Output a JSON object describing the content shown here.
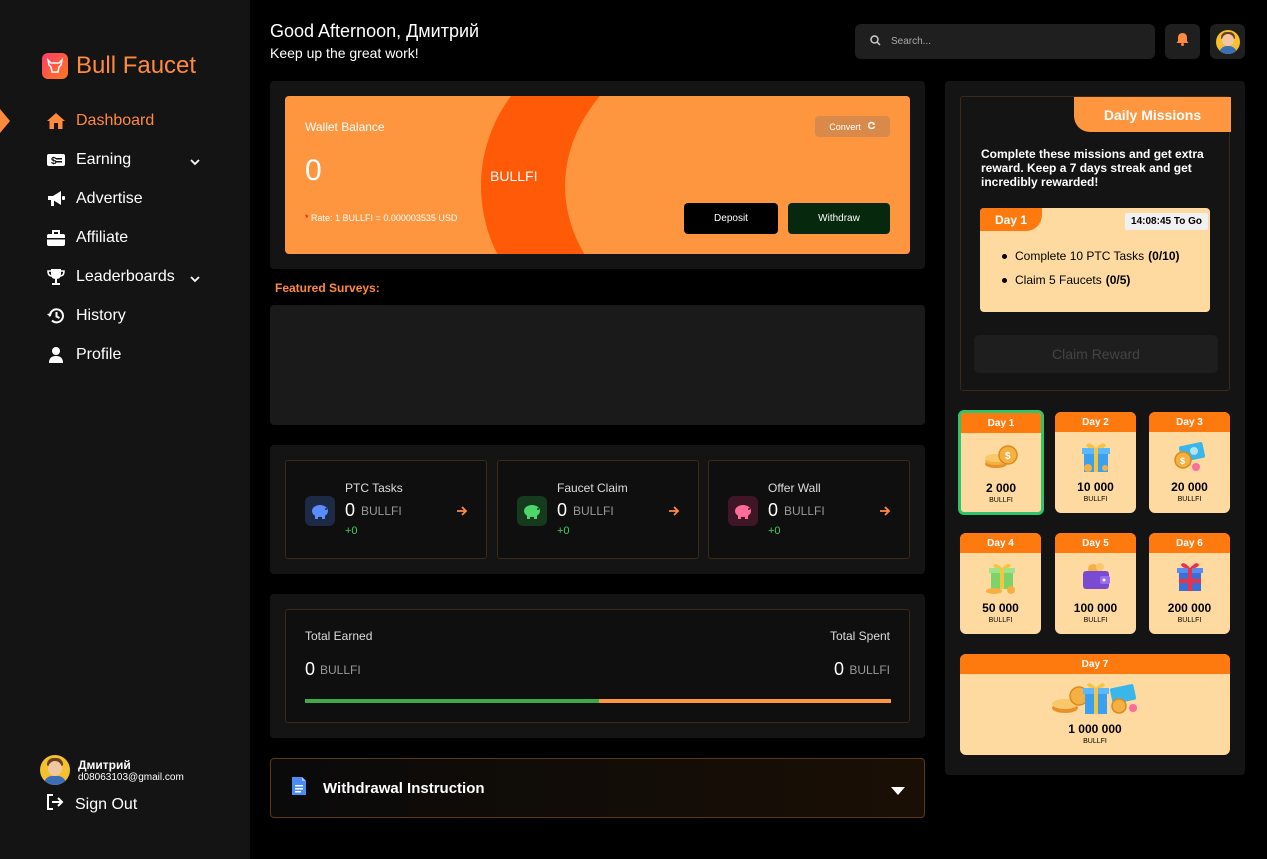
{
  "brand": {
    "name": "Bull Faucet",
    "icon": "bull-icon",
    "accent": "#ff8a3d"
  },
  "sidebar": {
    "items": [
      {
        "label": "Dashboard",
        "icon": "home-icon",
        "active": true
      },
      {
        "label": "Earning",
        "icon": "money-icon",
        "has_submenu": true
      },
      {
        "label": "Advertise",
        "icon": "megaphone-icon"
      },
      {
        "label": "Affiliate",
        "icon": "briefcase-icon"
      },
      {
        "label": "Leaderboards",
        "icon": "trophy-icon",
        "has_submenu": true
      },
      {
        "label": "History",
        "icon": "history-icon"
      },
      {
        "label": "Profile",
        "icon": "user-icon"
      }
    ],
    "user": {
      "name": "Дмитрий",
      "email": "d08063103@gmail.com"
    },
    "signout_label": "Sign Out"
  },
  "header": {
    "greeting": "Good Afternoon, Дмитрий",
    "subtitle": "Keep up the great work!",
    "search_placeholder": "Search..."
  },
  "wallet": {
    "label": "Wallet Balance",
    "balance": "0",
    "unit": "BULLFI",
    "rate_star": "*",
    "rate": "Rate: 1 BULLFI = 0.000003535 USD",
    "convert_label": "Convert",
    "deposit_label": "Deposit",
    "withdraw_label": "Withdraw"
  },
  "featured_surveys": {
    "title": "Featured Surveys:"
  },
  "stats": [
    {
      "title": "PTC Tasks",
      "value": "0",
      "unit": "BULLFI",
      "delta": "+0",
      "icon": "piggy-bank-icon",
      "color": "#5b8cff",
      "bg": "#1c2a45"
    },
    {
      "title": "Faucet Claim",
      "value": "0",
      "unit": "BULLFI",
      "delta": "+0",
      "icon": "piggy-bank-icon",
      "color": "#4fd66b",
      "bg": "#163a1e"
    },
    {
      "title": "Offer Wall",
      "value": "0",
      "unit": "BULLFI",
      "delta": "+0",
      "icon": "piggy-bank-icon",
      "color": "#ff6b9a",
      "bg": "#3e1626"
    }
  ],
  "totals": {
    "earned_label": "Total Earned",
    "earned_value": "0",
    "spent_label": "Total Spent",
    "spent_value": "0",
    "unit": "BULLFI"
  },
  "withdrawal": {
    "label": "Withdrawal Instruction",
    "icon": "document-icon"
  },
  "missions": {
    "title": "Daily Missions",
    "description": "Complete these missions and get extra reward. Keep a 7 days streak and get incredibly rewarded!",
    "day_label": "Day 1",
    "timer": "14:08:45 To Go",
    "tasks": [
      {
        "label": "Complete 10 PTC Tasks",
        "progress": "(0/10)"
      },
      {
        "label": "Claim 5 Faucets",
        "progress": "(0/5)"
      }
    ],
    "claim_label": "Claim Reward"
  },
  "rewards": [
    {
      "day": "Day 1",
      "value": "2 000",
      "unit": "BULLFI",
      "icon": "coins-icon",
      "current": true
    },
    {
      "day": "Day 2",
      "value": "10 000",
      "unit": "BULLFI",
      "icon": "gift-icon"
    },
    {
      "day": "Day 3",
      "value": "20 000",
      "unit": "BULLFI",
      "icon": "cash-icon"
    },
    {
      "day": "Day 4",
      "value": "50 000",
      "unit": "BULLFI",
      "icon": "gift-icon"
    },
    {
      "day": "Day 5",
      "value": "100 000",
      "unit": "BULLFI",
      "icon": "wallet-icon"
    },
    {
      "day": "Day 6",
      "value": "200 000",
      "unit": "BULLFI",
      "icon": "gift-icon"
    },
    {
      "day": "Day 7",
      "value": "1 000 000",
      "unit": "BULLFI",
      "icon": "treasure-icon"
    }
  ]
}
